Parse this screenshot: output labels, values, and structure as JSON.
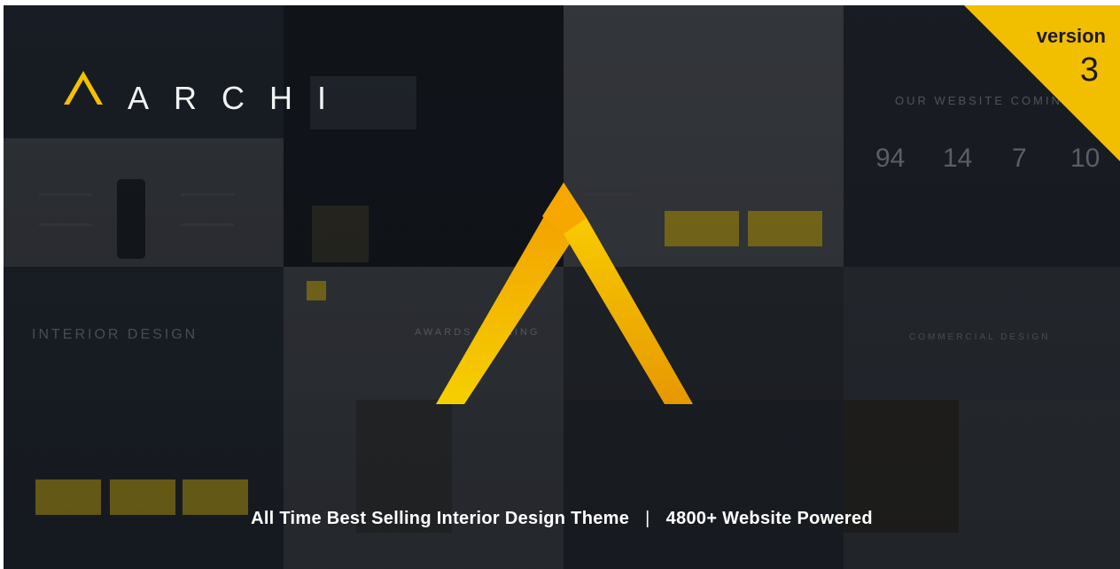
{
  "brand": {
    "name": "ARCHI",
    "accent_color": "#f5c000",
    "accent_dark": "#f29b00"
  },
  "badge": {
    "label": "version",
    "number": "3",
    "color": "#f2be00"
  },
  "tagline": {
    "left": "All Time Best Selling Interior Design Theme",
    "separator": "|",
    "right": "4800+ Website Powered"
  },
  "background_previews": {
    "headline_1": "INTERIOR DESIGN",
    "headline_2": "AWARDS WINNING",
    "headline_3": "COMMERCIAL DESIGN",
    "headline_4": "OUR WEBSITE COMING SOON",
    "countdown": [
      "94",
      "14",
      "7",
      "10"
    ]
  }
}
